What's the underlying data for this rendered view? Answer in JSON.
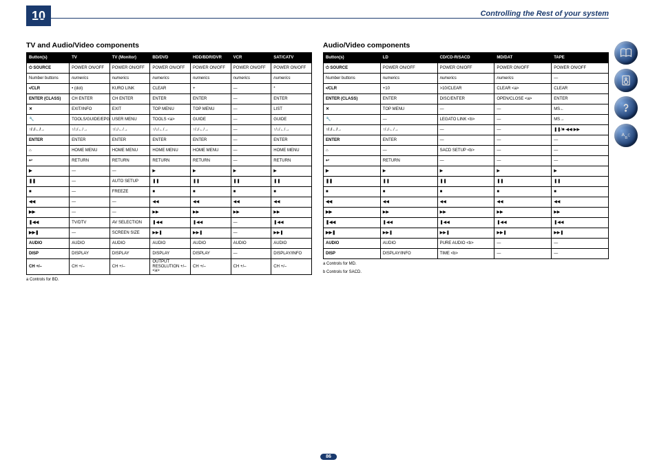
{
  "chapter_number": "10",
  "page_title": "Controlling the Rest of your system",
  "page_number": "86",
  "left": {
    "title": "TV and Audio/Video components",
    "headers": [
      "Button(s)",
      "TV",
      "TV (Monitor)",
      "BD/DVD",
      "HDD/BDR/DVR",
      "VCR",
      "SAT/CATV"
    ],
    "rows": [
      {
        "b": 1,
        "cells": [
          "⏻ SOURCE",
          "POWER ON/OFF",
          "POWER ON/OFF",
          "POWER ON/OFF",
          "POWER ON/OFF",
          "POWER ON/OFF",
          "POWER ON/OFF"
        ]
      },
      {
        "cells": [
          "Number buttons",
          "numerics",
          "numerics",
          "numerics",
          "numerics",
          "numerics",
          "numerics"
        ],
        "i": [
          1,
          2,
          3,
          4,
          5,
          6
        ]
      },
      {
        "b": 1,
        "cells": [
          "•/CLR",
          "• (dot)",
          "KURO LINK",
          "CLEAR",
          "+",
          "—",
          "*"
        ]
      },
      {
        "cells": [
          "ENTER (CLASS)",
          "CH ENTER",
          "CH ENTER",
          "ENTER",
          "ENTER",
          "—",
          "ENTER"
        ],
        "bpart": 1
      },
      {
        "b": 1,
        "cells": [
          "✕",
          "EXIT/INFO",
          "EXIT",
          "TOP MENU",
          "TOP MENU",
          "—",
          "LIST"
        ]
      },
      {
        "b": 1,
        "cells": [
          "🔧",
          "TOOLS/GUIDE/EPG",
          "USER MENU",
          "TOOLS <a>",
          "GUIDE",
          "—",
          "GUIDE"
        ]
      },
      {
        "b": 1,
        "cells": [
          "↑/↓/←/→",
          "↑/↓/←/→",
          "↑/↓/←/→",
          "↑/↓/←/→",
          "↑/↓/←/→",
          "—",
          "↑/↓/←/→"
        ]
      },
      {
        "b": 1,
        "cells": [
          "ENTER",
          "ENTER",
          "ENTER",
          "ENTER",
          "ENTER",
          "—",
          "ENTER"
        ]
      },
      {
        "b": 1,
        "cells": [
          "⌂",
          "HOME MENU",
          "HOME MENU",
          "HOME MENU",
          "HOME MENU",
          "—",
          "HOME MENU"
        ]
      },
      {
        "b": 1,
        "cells": [
          "↩",
          "RETURN",
          "RETURN",
          "RETURN",
          "RETURN",
          "—",
          "RETURN"
        ]
      },
      {
        "b": 1,
        "cells": [
          "▶",
          "—",
          "—",
          "▶",
          "▶",
          "▶",
          "▶"
        ]
      },
      {
        "b": 1,
        "cells": [
          "❚❚",
          "—",
          "AUTO SETUP",
          "❚❚",
          "❚❚",
          "❚❚",
          "❚❚"
        ]
      },
      {
        "b": 1,
        "cells": [
          "■",
          "—",
          "FREEZE",
          "■",
          "■",
          "■",
          "■"
        ]
      },
      {
        "b": 1,
        "cells": [
          "◀◀",
          "—",
          "—",
          "◀◀",
          "◀◀",
          "◀◀",
          "◀◀"
        ]
      },
      {
        "b": 1,
        "cells": [
          "▶▶",
          "—",
          "—",
          "▶▶",
          "▶▶",
          "▶▶",
          "▶▶"
        ]
      },
      {
        "b": 1,
        "cells": [
          "❚◀◀",
          "TV/DTV",
          "AV SELECTION",
          "❚◀◀",
          "❚◀◀",
          "—",
          "❚◀◀"
        ]
      },
      {
        "b": 1,
        "cells": [
          "▶▶❚",
          "—",
          "SCREEN SIZE",
          "▶▶❚",
          "▶▶❚",
          "—",
          "▶▶❚"
        ]
      },
      {
        "b": 1,
        "cells": [
          "AUDIO",
          "AUDIO",
          "AUDIO",
          "AUDIO",
          "AUDIO",
          "AUDIO",
          "AUDIO"
        ]
      },
      {
        "b": 1,
        "cells": [
          "DISP",
          "DISPLAY",
          "DISPLAY",
          "DISPLAY",
          "DISPLAY",
          "—",
          "DISPLAY/INFO"
        ]
      },
      {
        "b": 1,
        "cells": [
          "CH +/–",
          "CH +/–",
          "CH +/–",
          "OUTPUT RESOLUTION +/– <a>",
          "CH +/–",
          "CH +/–",
          "CH +/–"
        ]
      }
    ],
    "footnote": "a  Controls for BD."
  },
  "right": {
    "title": "Audio/Video components",
    "headers": [
      "Button(s)",
      "LD",
      "CD/CD-R/SACD",
      "MD/DAT",
      "TAPE"
    ],
    "rows": [
      {
        "b": 1,
        "cells": [
          "⏻ SOURCE",
          "POWER ON/OFF",
          "POWER ON/OFF",
          "POWER ON/OFF",
          "POWER ON/OFF"
        ]
      },
      {
        "cells": [
          "Number buttons",
          "numerics",
          "numerics",
          "numerics",
          "—"
        ],
        "i": [
          1,
          2,
          3
        ]
      },
      {
        "b": 1,
        "cells": [
          "•/CLR",
          "+10",
          ">10/CLEAR",
          "CLEAR <a>",
          "CLEAR"
        ]
      },
      {
        "cells": [
          "ENTER (CLASS)",
          "ENTER",
          "DISC/ENTER",
          "OPEN/CLOSE <a>",
          "ENTER"
        ],
        "bpart": 1
      },
      {
        "b": 1,
        "cells": [
          "✕",
          "TOP MENU",
          "—",
          "—",
          "MS←"
        ]
      },
      {
        "b": 1,
        "cells": [
          "🔧",
          "—",
          "LEGATO LINK <b>",
          "—",
          "MS→"
        ]
      },
      {
        "b": 1,
        "cells": [
          "↑/↓/←/→",
          "↑/↓/←/→",
          "—",
          "—",
          "❚❚/■·◀◀·▶▶"
        ]
      },
      {
        "b": 1,
        "cells": [
          "ENTER",
          "ENTER",
          "—",
          "—",
          "—"
        ]
      },
      {
        "b": 1,
        "cells": [
          "⌂",
          "—",
          "SACD SETUP <b>",
          "—",
          "—"
        ]
      },
      {
        "b": 1,
        "cells": [
          "↩",
          "RETURN",
          "—",
          "—",
          "—"
        ]
      },
      {
        "b": 1,
        "cells": [
          "▶",
          "▶",
          "▶",
          "▶",
          "▶"
        ]
      },
      {
        "b": 1,
        "cells": [
          "❚❚",
          "❚❚",
          "❚❚",
          "❚❚",
          "❚❚"
        ]
      },
      {
        "b": 1,
        "cells": [
          "■",
          "■",
          "■",
          "■",
          "■"
        ]
      },
      {
        "b": 1,
        "cells": [
          "◀◀",
          "◀◀",
          "◀◀",
          "◀◀",
          "◀◀"
        ]
      },
      {
        "b": 1,
        "cells": [
          "▶▶",
          "▶▶",
          "▶▶",
          "▶▶",
          "▶▶"
        ]
      },
      {
        "b": 1,
        "cells": [
          "❚◀◀",
          "❚◀◀",
          "❚◀◀",
          "❚◀◀",
          "❚◀◀"
        ]
      },
      {
        "b": 1,
        "cells": [
          "▶▶❚",
          "▶▶❚",
          "▶▶❚",
          "▶▶❚",
          "▶▶❚"
        ]
      },
      {
        "b": 1,
        "cells": [
          "AUDIO",
          "AUDIO",
          "PURE AUDIO <b>",
          "—",
          "—"
        ]
      },
      {
        "b": 1,
        "cells": [
          "DISP",
          "DISPLAY/INFO",
          "TIME <b>",
          "—",
          "—"
        ]
      }
    ],
    "footnote_a": "a  Controls for MD.",
    "footnote_b": "b  Controls for SACD."
  },
  "icons": [
    "book",
    "speaker",
    "question",
    "abc"
  ]
}
